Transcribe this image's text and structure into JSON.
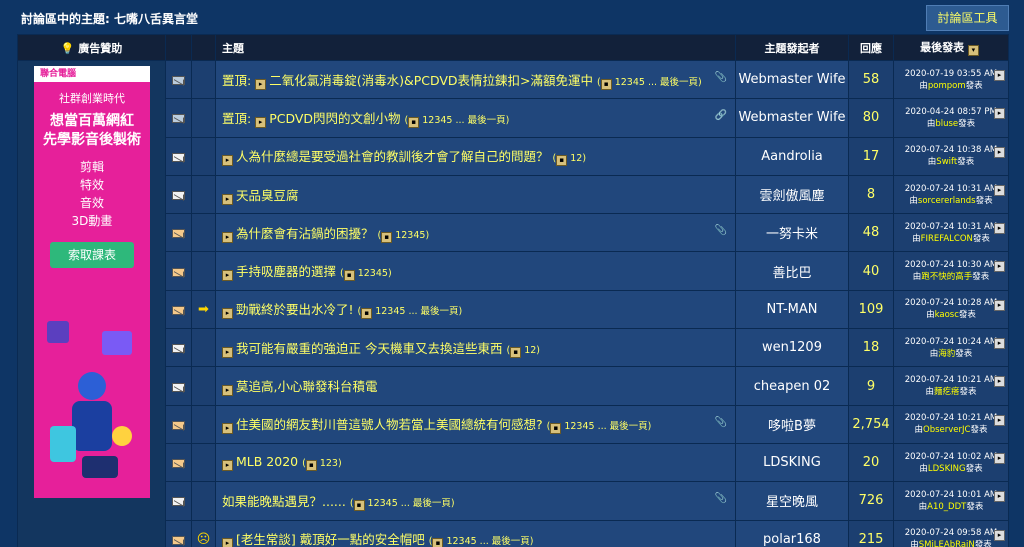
{
  "header": {
    "forum_title": "討論區中的主題: 七嘴八舌異言堂",
    "tools_label": "討論區工具"
  },
  "columns": {
    "ad": "廣告贊助",
    "topic": "主題",
    "starter": "主題發起者",
    "replies": "回應",
    "last": "最後發表"
  },
  "ad": {
    "brand": "聯合電腦",
    "subtitle": "社群創業時代",
    "headline1": "想當百萬網紅",
    "headline2": "先學影音後製術",
    "items": [
      "剪輯",
      "特效",
      "音效",
      "3D動畫"
    ],
    "cta": "索取課表"
  },
  "threads": [
    {
      "icon": "envelope-icon",
      "prefix": "置頂: ",
      "title": "二氧化氯消毒錠(消毒水)&PCDVD表情拉鍊扣>滿額免運中",
      "pages": "12345 ... 最後一頁",
      "attach": "📎",
      "starter": "Webmaster Wife",
      "replies": "58",
      "date": "2020-07-19 03:55 AM",
      "by_prefix": "由",
      "user": "pompom",
      "by_suffix": "發表"
    },
    {
      "icon": "envelope-icon",
      "prefix": "置頂: ",
      "title": "PCDVD閃閃的文創小物",
      "pages": "12345 ... 最後一頁",
      "attach": "🔗",
      "starter": "Webmaster Wife",
      "replies": "80",
      "date": "2020-04-24 08:57 PM",
      "by_prefix": "由",
      "user": "bluse",
      "by_suffix": "發表"
    },
    {
      "icon": "envelope-icon",
      "prefix": "",
      "title": "人為什麼總是要受過社會的教訓後才會了解自己的問題？",
      "pages": "12",
      "attach": "",
      "starter": "Aandrolia",
      "replies": "17",
      "date": "2020-07-24 10:38 AM",
      "by_prefix": "由",
      "user": "Swift",
      "by_suffix": "發表"
    },
    {
      "icon": "envelope-icon",
      "prefix": "",
      "title": "天品臭豆腐",
      "pages": "",
      "attach": "",
      "starter": "雲劍傲風塵",
      "replies": "8",
      "date": "2020-07-24 10:31 AM",
      "by_prefix": "由",
      "user": "sorcererlands",
      "by_suffix": "發表"
    },
    {
      "icon": "hot-envelope-icon",
      "prefix": "",
      "title": "為什麼會有沾鍋的困擾？",
      "pages": "12345",
      "attach": "📎",
      "starter": "一努卡米",
      "replies": "48",
      "date": "2020-07-24 10:31 AM",
      "by_prefix": "由",
      "user": "FIREFALCON",
      "by_suffix": "發表"
    },
    {
      "icon": "hot-envelope-icon",
      "prefix": "",
      "title": "手持吸塵器的選擇",
      "pages": "12345",
      "attach": "",
      "starter": "善比巴",
      "replies": "40",
      "date": "2020-07-24 10:30 AM",
      "by_prefix": "由",
      "user": "跑不快的高手",
      "by_suffix": "發表"
    },
    {
      "icon": "hot-envelope-icon",
      "prefix": "",
      "title": "勁戰終於要出水冷了!",
      "pages": "12345 ... 最後一頁",
      "attach": "",
      "starter": "NT-MAN",
      "replies": "109",
      "date": "2020-07-24 10:28 AM",
      "by_prefix": "由",
      "user": "kaosc",
      "by_suffix": "發表",
      "arrow": "➡"
    },
    {
      "icon": "envelope-icon",
      "prefix": "",
      "title": "我可能有嚴重的強迫正 今天機車又去換這些東西",
      "pages": "12",
      "attach": "",
      "starter": "wen1209",
      "replies": "18",
      "date": "2020-07-24 10:24 AM",
      "by_prefix": "由",
      "user": "海豹",
      "by_suffix": "發表"
    },
    {
      "icon": "envelope-icon",
      "prefix": "",
      "title": "莫追高,小心聯發科台積電",
      "pages": "",
      "attach": "",
      "starter": "cheapen 02",
      "replies": "9",
      "date": "2020-07-24 10:21 AM",
      "by_prefix": "由",
      "user": "麵疙瘩",
      "by_suffix": "發表"
    },
    {
      "icon": "hot-envelope-icon",
      "prefix": "",
      "title": "住美國的網友對川普這號人物若當上美國總統有何感想?",
      "pages": "12345 ... 最後一頁",
      "attach": "📎",
      "starter": "哆啦B夢",
      "replies": "2,754",
      "date": "2020-07-24 10:21 AM",
      "by_prefix": "由",
      "user": "ObserverJC",
      "by_suffix": "發表"
    },
    {
      "icon": "hot-envelope-icon",
      "prefix": "",
      "title": "MLB 2020",
      "pages": "123",
      "attach": "",
      "starter": "LDSKING",
      "replies": "20",
      "date": "2020-07-24 10:02 AM",
      "by_prefix": "由",
      "user": "LDSKING",
      "by_suffix": "發表"
    },
    {
      "icon": "envelope-icon",
      "prefix": "",
      "title": "如果能晚點遇見？......",
      "pages": "12345 ... 最後一頁",
      "attach": "📎",
      "starter": "星空晚風",
      "replies": "726",
      "date": "2020-07-24 10:01 AM",
      "by_prefix": "由",
      "user": "A10_DDT",
      "by_suffix": "發表",
      "notag": true
    },
    {
      "icon": "hot-envelope-icon",
      "prefix": "",
      "title": "[老生常談] 戴頂好一點的安全帽吧",
      "pages": "12345 ... 最後一頁",
      "attach": "",
      "starter": "polar168",
      "replies": "215",
      "date": "2020-07-24 09:58 AM",
      "by_prefix": "由",
      "user": "SMiLEAbRaiN",
      "by_suffix": "發表",
      "arrow": "☹"
    }
  ]
}
